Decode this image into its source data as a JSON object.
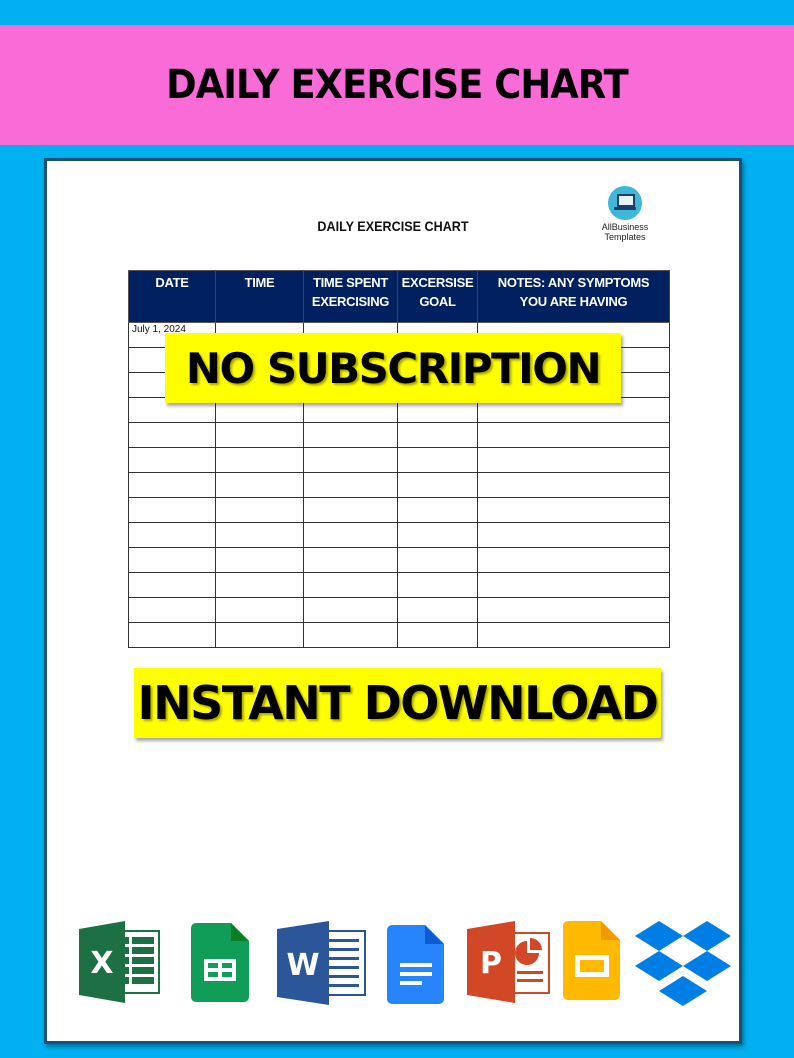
{
  "banner": {
    "title": "DAILY EXERCISE CHART",
    "color": "#f96bd6"
  },
  "colors": {
    "background": "#00b0f0",
    "table_header": "#002060",
    "promo": "#ffff00",
    "doc_border": "#1f4e79"
  },
  "document": {
    "title": "DAILY EXERCISE CHART",
    "brand": {
      "line1": "AllBusiness",
      "line2": "Templates",
      "icon": "laptop-icon"
    },
    "table": {
      "headers": [
        [
          "DATE"
        ],
        [
          "TIME"
        ],
        [
          "TIME SPENT",
          "EXERCISING"
        ],
        [
          "EXCERSISE",
          "GOAL"
        ],
        [
          "NOTES: ANY SYMPTOMS",
          "YOU ARE HAVING"
        ]
      ],
      "rows": [
        [
          "July 1, 2024",
          "",
          "",
          "",
          ""
        ],
        [
          "",
          "",
          "",
          "",
          ""
        ],
        [
          "",
          "",
          "",
          "",
          ""
        ],
        [
          "",
          "",
          "",
          "",
          ""
        ],
        [
          "",
          "",
          "",
          "",
          ""
        ],
        [
          "",
          "",
          "",
          "",
          ""
        ],
        [
          "",
          "",
          "",
          "",
          ""
        ],
        [
          "",
          "",
          "",
          "",
          ""
        ],
        [
          "",
          "",
          "",
          "",
          ""
        ],
        [
          "",
          "",
          "",
          "",
          ""
        ],
        [
          "",
          "",
          "",
          "",
          ""
        ],
        [
          "",
          "",
          "",
          "",
          ""
        ],
        [
          "",
          "",
          "",
          "",
          ""
        ]
      ]
    },
    "promos": [
      "NO SUBSCRIPTION",
      "INSTANT DOWNLOAD"
    ]
  },
  "app_icons": [
    {
      "name": "excel-icon",
      "letter": "X",
      "color": "#1d7044"
    },
    {
      "name": "google-sheets-icon",
      "letter": "",
      "color": "#0f9d58"
    },
    {
      "name": "word-icon",
      "letter": "W",
      "color": "#2b579a"
    },
    {
      "name": "google-docs-icon",
      "letter": "",
      "color": "#2684fc"
    },
    {
      "name": "powerpoint-icon",
      "letter": "P",
      "color": "#d24726"
    },
    {
      "name": "google-slides-icon",
      "letter": "",
      "color": "#ffba00"
    },
    {
      "name": "dropbox-icon",
      "letter": "",
      "color": "#007ee5"
    }
  ]
}
